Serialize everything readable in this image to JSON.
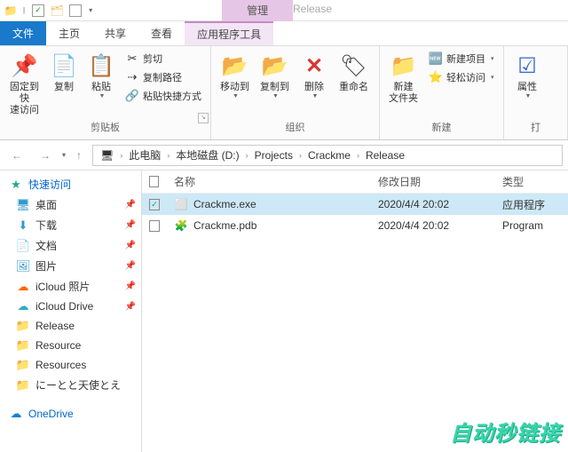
{
  "titlebar": {
    "context_tab": "管理",
    "context_title": "Release"
  },
  "tabs": {
    "file": "文件",
    "home": "主页",
    "share": "共享",
    "view": "查看",
    "app_tools": "应用程序工具"
  },
  "ribbon": {
    "clipboard": {
      "label": "剪贴板",
      "pin": "固定到快\n速访问",
      "copy": "复制",
      "paste": "粘贴",
      "cut": "剪切",
      "copy_path": "复制路径",
      "paste_shortcut": "粘贴快捷方式"
    },
    "organize": {
      "label": "组织",
      "move_to": "移动到",
      "copy_to": "复制到",
      "delete": "删除",
      "rename": "重命名"
    },
    "new": {
      "label": "新建",
      "new_folder": "新建\n文件夹",
      "new_item": "新建项目",
      "easy_access": "轻松访问"
    },
    "open": {
      "label": "打",
      "properties": "属性"
    }
  },
  "breadcrumb": {
    "pc": "此电脑",
    "drive": "本地磁盘 (D:)",
    "p1": "Projects",
    "p2": "Crackme",
    "p3": "Release"
  },
  "sidebar": {
    "quick": "快速访问",
    "items": [
      "桌面",
      "下载",
      "文档",
      "图片",
      "iCloud 照片",
      "iCloud Drive",
      "Release",
      "Resource",
      "Resources",
      "にーとと天使とえ"
    ],
    "onedrive": "OneDrive"
  },
  "columns": {
    "name": "名称",
    "date": "修改日期",
    "type": "类型"
  },
  "files": [
    {
      "name": "Crackme.exe",
      "date": "2020/4/4 20:02",
      "type": "应用程序",
      "selected": true,
      "icon": "exe"
    },
    {
      "name": "Crackme.pdb",
      "date": "2020/4/4 20:02",
      "type": "Program",
      "selected": false,
      "icon": "pdb"
    }
  ],
  "watermark": "自动秒链接"
}
